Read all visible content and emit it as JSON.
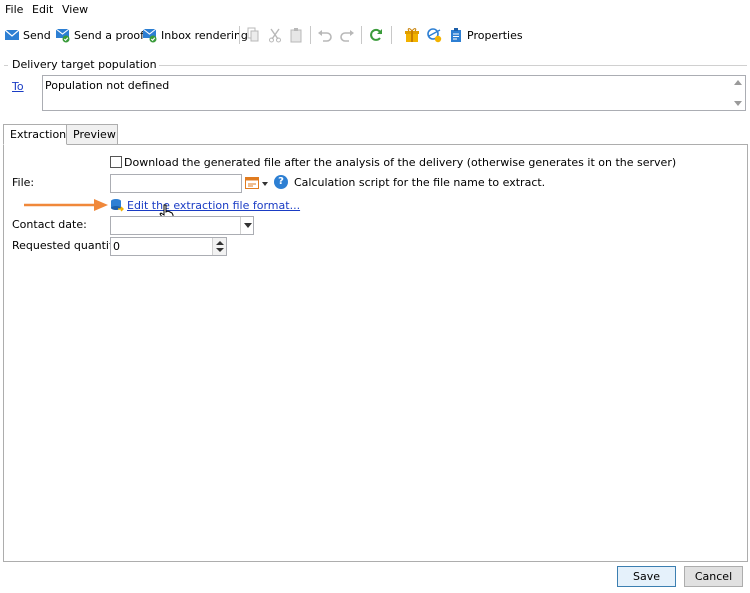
{
  "menu": {
    "file": "File",
    "edit": "Edit",
    "view": "View"
  },
  "toolbar": {
    "send": "Send",
    "send_proof": "Send a proof",
    "inbox_rendering": "Inbox rendering",
    "properties": "Properties"
  },
  "target_group": {
    "title": "Delivery target population",
    "to_link": "To",
    "population_value": "Population not defined"
  },
  "tabs": [
    {
      "label": "Extraction",
      "active": true
    },
    {
      "label": "Preview",
      "active": false
    }
  ],
  "extraction": {
    "download_checkbox_label": "Download the generated file after the analysis of the delivery (otherwise generates it on the server)",
    "download_checked": false,
    "file_label": "File:",
    "file_value": "",
    "calc_script_text": "Calculation script for the file name to extract.",
    "edit_format_link": "Edit the extraction file format...",
    "contact_date_label": "Contact date:",
    "contact_date_value": "",
    "requested_quantity_label": "Requested quantity:",
    "requested_quantity_value": "0"
  },
  "footer": {
    "save": "Save",
    "cancel": "Cancel"
  },
  "colors": {
    "accent_arrow": "#f0883a",
    "link": "#1a3cc4",
    "icon_blue": "#2d7fd3",
    "icon_green": "#3a9b3a",
    "icon_yellow": "#f2b200"
  },
  "icons": [
    "send-icon",
    "send-proof-icon",
    "inbox-rendering-icon",
    "copy-icon",
    "cut-icon",
    "paste-icon",
    "undo-icon",
    "redo-icon",
    "refresh-icon",
    "gift-icon",
    "check-icon",
    "properties-icon",
    "help-icon",
    "edit-format-icon",
    "hand-cursor-icon",
    "arrow-icon"
  ]
}
